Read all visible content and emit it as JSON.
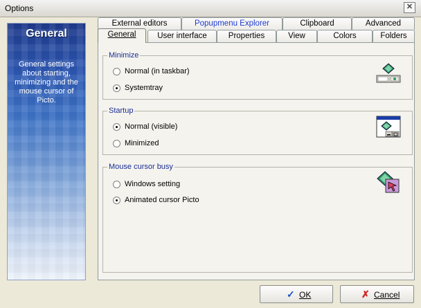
{
  "window": {
    "title": "Options",
    "close_glyph": "✕"
  },
  "sidebar": {
    "title": "General",
    "description": "General settings about starting, minimizing and the mouse cursor of Picto."
  },
  "tabs_back": [
    "External editors",
    "Popupmenu Explorer",
    "Clipboard",
    "Advanced"
  ],
  "tabs_front": [
    "General",
    "User interface",
    "Properties",
    "View",
    "Colors",
    "Folders"
  ],
  "selected_tab": "General",
  "groups": {
    "minimize": {
      "label": "Minimize",
      "options": [
        "Normal (in taskbar)",
        "Systemtray"
      ],
      "selected": 1
    },
    "startup": {
      "label": "Startup",
      "options": [
        "Normal (visible)",
        "Minimized"
      ],
      "selected": 0
    },
    "mouse": {
      "label": "Mouse cursor busy",
      "options": [
        "Windows setting",
        "Animated cursor Picto"
      ],
      "selected": 1
    }
  },
  "icons": {
    "minimize": "tray-pie-icon",
    "startup": "window-pie-icon",
    "mouse": "cursor-pie-icon"
  },
  "buttons": {
    "ok": "OK",
    "cancel": "Cancel",
    "ok_icon": "checkmark-icon",
    "cancel_icon": "x-icon"
  },
  "colors": {
    "sidebar_top": "#1f3a8c",
    "legend_text": "#1b2e92",
    "check_blue": "#1a52c4",
    "cancel_red": "#d02020"
  }
}
